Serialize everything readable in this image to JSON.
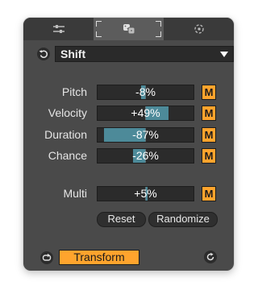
{
  "tabs": [
    {
      "icon": "sliders-icon",
      "active": false
    },
    {
      "icon": "dice-icon",
      "active": true
    },
    {
      "icon": "target-icon",
      "active": false
    }
  ],
  "preset": {
    "selected": "Shift"
  },
  "params": [
    {
      "label": "Pitch",
      "value": "-8%",
      "amount": -8,
      "mod_button": "M"
    },
    {
      "label": "Velocity",
      "value": "+49%",
      "amount": 49,
      "mod_button": "M"
    },
    {
      "label": "Duration",
      "value": "-87%",
      "amount": -87,
      "mod_button": "M"
    },
    {
      "label": "Chance",
      "value": "-26%",
      "amount": -26,
      "mod_button": "M"
    },
    {
      "label": "Multi",
      "value": "+5%",
      "amount": 5,
      "mod_button": "M"
    }
  ],
  "buttons": {
    "reset": "Reset",
    "randomize": "Randomize",
    "transform": "Transform"
  },
  "colors": {
    "accent": "#ffa42d",
    "fill": "#4d8a99",
    "panel": "#4a4a4a"
  }
}
